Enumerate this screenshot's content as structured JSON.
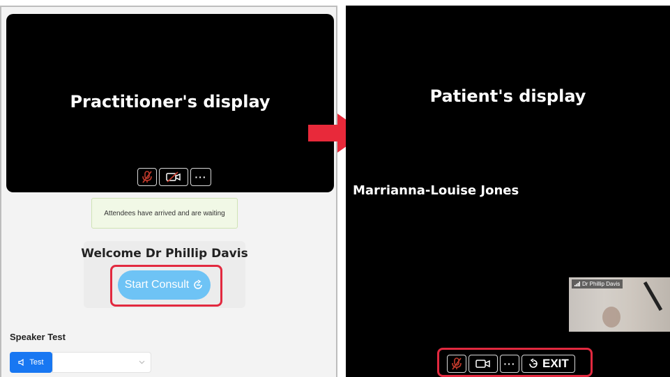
{
  "practitioner_panel": {
    "caption": "Practitioner's display",
    "notice": "Attendees have arrived and are waiting",
    "welcome": "Welcome Dr Phillip Davis",
    "start_button_label": "Start Consult",
    "speaker_section_label": "Speaker Test",
    "test_button_label": "Test",
    "controls": {
      "more_label": "···"
    }
  },
  "patient_panel": {
    "caption": "Patient's display",
    "patient_name": "Marrianna-Louise Jones",
    "self_view_name": "Dr Phillip Davis",
    "exit_label": "EXIT",
    "controls": {
      "more_label": "···"
    }
  },
  "icons": {
    "mic": "mic-muted-icon",
    "camera": "camera-off-icon",
    "start": "rotate-right-icon",
    "speaker": "speaker-icon",
    "dropdown": "chevron-down-icon",
    "signal": "signal-icon",
    "exit": "rotate-left-icon",
    "arrow": "arrow-right-icon"
  },
  "colors": {
    "highlight": "#e2293f",
    "start_button": "#6ec3f5",
    "test_button": "#1877f2",
    "arrow": "#e8293a",
    "notice_bg": "#f1f8e6"
  }
}
